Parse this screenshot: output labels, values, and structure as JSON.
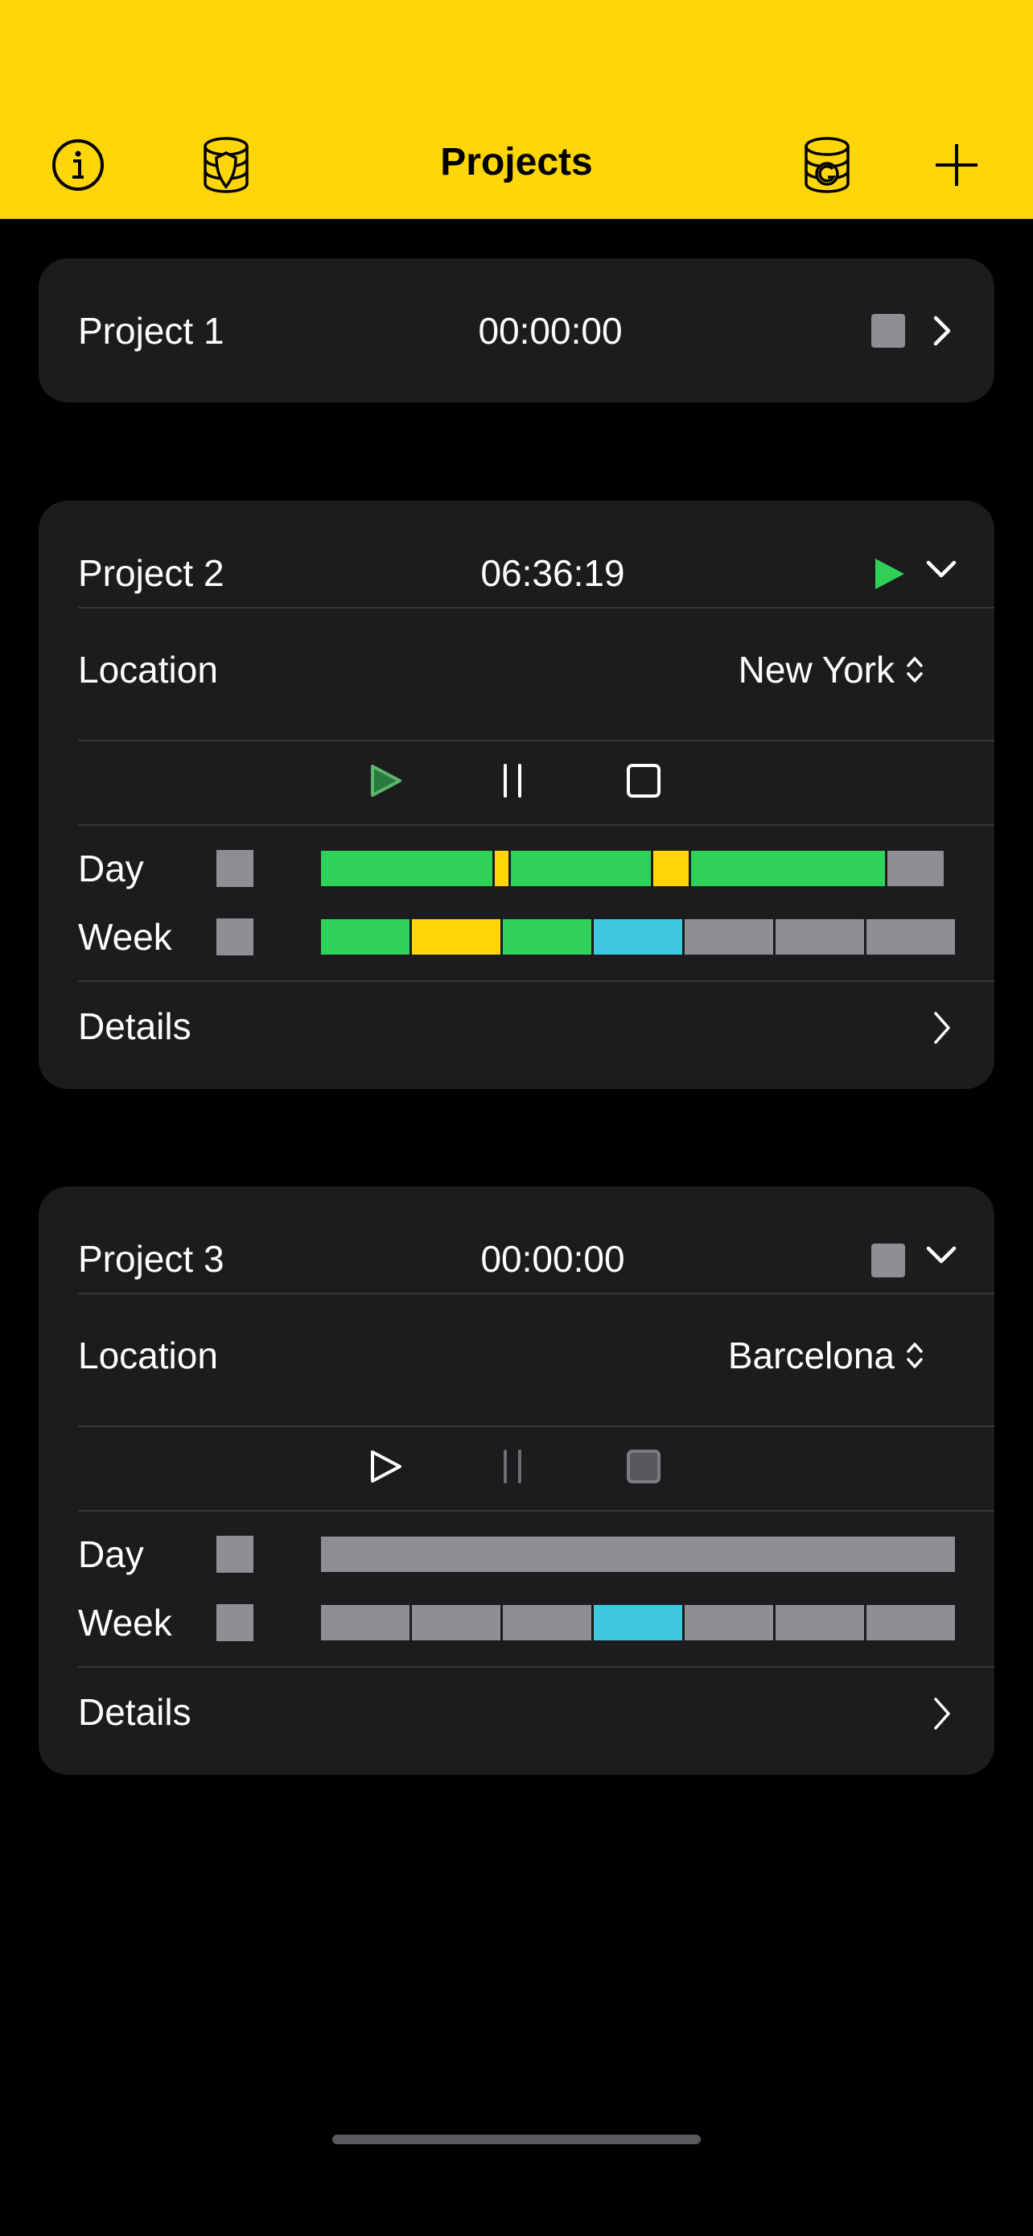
{
  "header": {
    "title": "Projects",
    "icons": [
      "info-icon",
      "database-shield-icon",
      "database-g-icon",
      "plus-icon"
    ]
  },
  "colors": {
    "header": "#ffd60a",
    "green": "#30d158",
    "yellow": "#ffd60a",
    "cyan": "#40c8e0",
    "gray": "#8e8e93"
  },
  "projects": [
    {
      "name": "Project 1",
      "time": "00:00:00",
      "state": "stopped",
      "expanded": false
    },
    {
      "name": "Project 2",
      "time": "06:36:19",
      "state": "running",
      "expanded": true,
      "location_label": "Location",
      "location": "New York",
      "day_label": "Day",
      "week_label": "Week",
      "details_label": "Details",
      "day": [
        {
          "status": "green",
          "fraction": 0.276
        },
        {
          "status": "yellow",
          "fraction": 0.021
        },
        {
          "status": "green",
          "fraction": 0.225
        },
        {
          "status": "yellow",
          "fraction": 0.058
        },
        {
          "status": "green",
          "fraction": 0.311
        },
        {
          "status": "gray",
          "fraction": 0.091
        }
      ],
      "week": [
        "green",
        "yellow",
        "green",
        "cyan",
        "gray",
        "gray",
        "gray"
      ]
    },
    {
      "name": "Project 3",
      "time": "00:00:00",
      "state": "stopped",
      "expanded": true,
      "location_label": "Location",
      "location": "Barcelona",
      "day_label": "Day",
      "week_label": "Week",
      "details_label": "Details",
      "day": [
        {
          "status": "gray",
          "fraction": 1
        }
      ],
      "week": [
        "gray",
        "gray",
        "gray",
        "cyan",
        "gray",
        "gray",
        "gray"
      ]
    }
  ]
}
